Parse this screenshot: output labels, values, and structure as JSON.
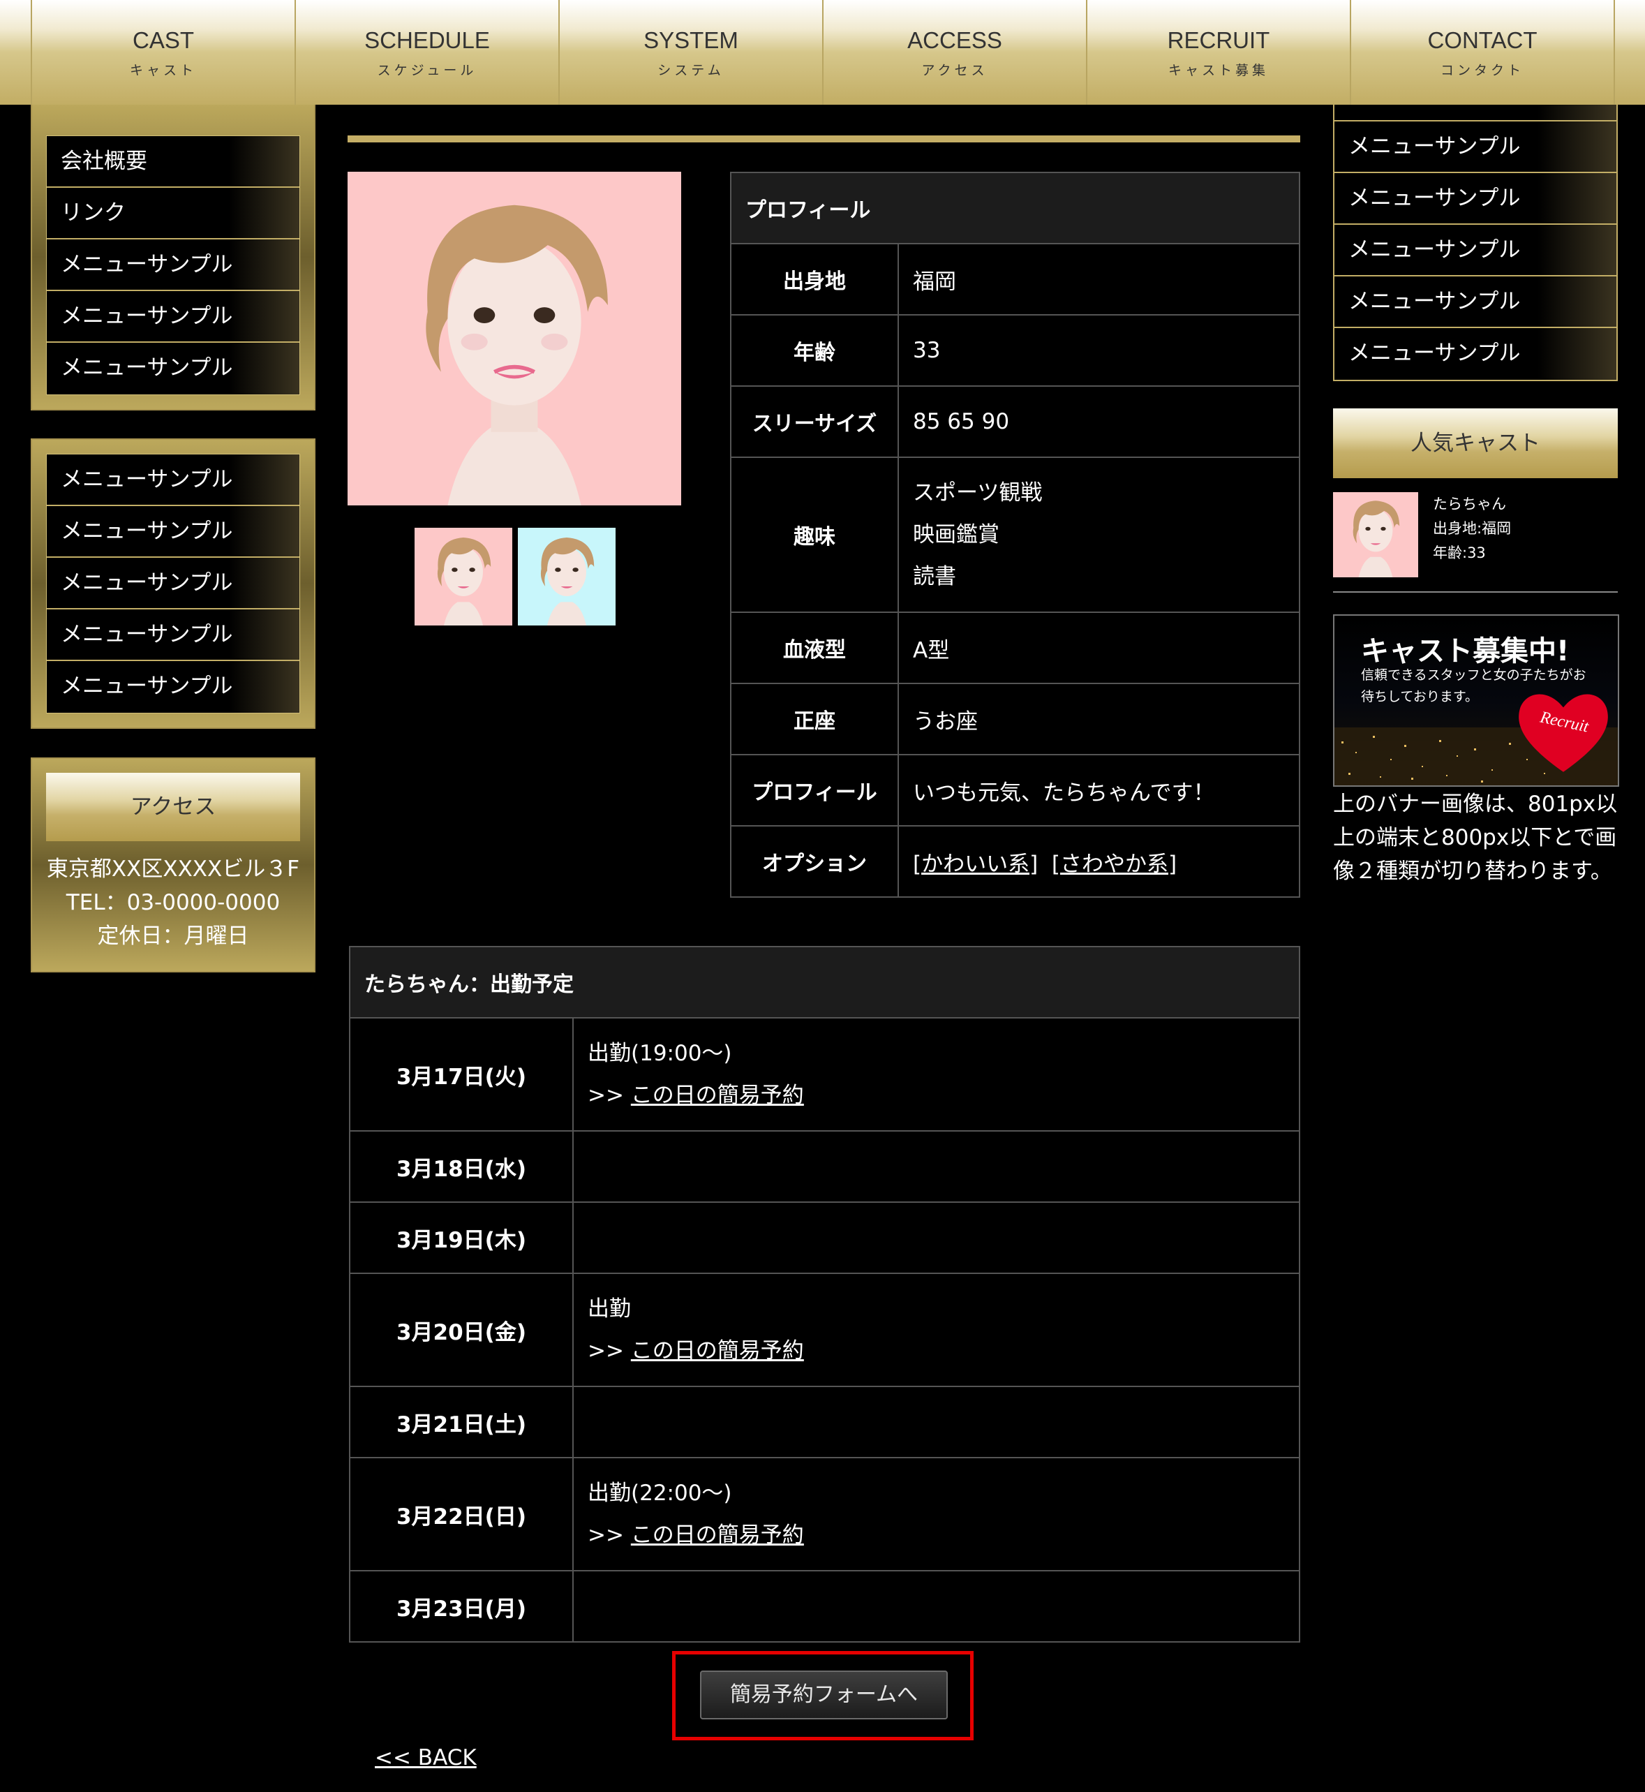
{
  "nav": [
    {
      "en": "CAST",
      "ja": "キャスト"
    },
    {
      "en": "SCHEDULE",
      "ja": "スケジュール"
    },
    {
      "en": "SYSTEM",
      "ja": "システム"
    },
    {
      "en": "ACCESS",
      "ja": "アクセス"
    },
    {
      "en": "RECRUIT",
      "ja": "キャスト募集"
    },
    {
      "en": "CONTACT",
      "ja": "コンタクト"
    }
  ],
  "left_menu_1": [
    "会社概要",
    "リンク",
    "メニューサンプル",
    "メニューサンプル",
    "メニューサンプル"
  ],
  "left_menu_2": [
    "メニューサンプル",
    "メニューサンプル",
    "メニューサンプル",
    "メニューサンプル",
    "メニューサンプル"
  ],
  "access": {
    "title": "アクセス",
    "address": "東京都XX区XXXXビル３F",
    "tel": "TEL：03-0000-0000",
    "holiday": "定休日：月曜日"
  },
  "profile": {
    "header": "プロフィール",
    "rows": {
      "birthplace": {
        "label": "出身地",
        "value": "福岡"
      },
      "age": {
        "label": "年齢",
        "value": "33"
      },
      "sizes": {
        "label": "スリーサイズ",
        "value": "85 65 90"
      },
      "hobby": {
        "label": "趣味",
        "values": [
          "スポーツ観戦",
          "映画鑑賞",
          "読書"
        ]
      },
      "blood": {
        "label": "血液型",
        "value": "A型"
      },
      "zodiac": {
        "label": "正座",
        "value": "うお座"
      },
      "profile": {
        "label": "プロフィール",
        "value": "いつも元気、たらちゃんです！"
      },
      "option": {
        "label": "オプション",
        "values": [
          "[かわいい系]",
          "[さわやか系]"
        ]
      }
    }
  },
  "schedule": {
    "header": "たらちゃん：出勤予定",
    "link_prefix": ">>",
    "link_label": "この日の簡易予約",
    "days": [
      {
        "date": "3月17日(火)",
        "status": "出勤(19:00〜)"
      },
      {
        "date": "3月18日(水)",
        "status": ""
      },
      {
        "date": "3月19日(木)",
        "status": ""
      },
      {
        "date": "3月20日(金)",
        "status": "出勤"
      },
      {
        "date": "3月21日(土)",
        "status": ""
      },
      {
        "date": "3月22日(日)",
        "status": "出勤(22:00〜)"
      },
      {
        "date": "3月23日(月)",
        "status": ""
      }
    ]
  },
  "form_button": "簡易予約フォームへ",
  "back_link": "<< BACK",
  "right_menu": [
    "メニューサンプル",
    "メニューサンプル",
    "メニューサンプル",
    "メニューサンプル",
    "メニューサンプル"
  ],
  "popular": {
    "title": "人気キャスト",
    "name": "たらちゃん",
    "birthplace": "出身地:福岡",
    "age": "年齢:33"
  },
  "banner": {
    "headline": "キャスト募集中!",
    "sub": "信頼できるスタッフと女の子たちがお待ちしております。",
    "heart": "Recruit"
  },
  "banner_note": "上のバナー画像は、801px以上の端末と800px以下とで画像２種類が切り替わります。",
  "colors": {
    "gold": "#c5ae66",
    "highlight": "#e60000",
    "photo_pink": "#fdc8c8",
    "photo_blue": "#c8f6fb"
  }
}
